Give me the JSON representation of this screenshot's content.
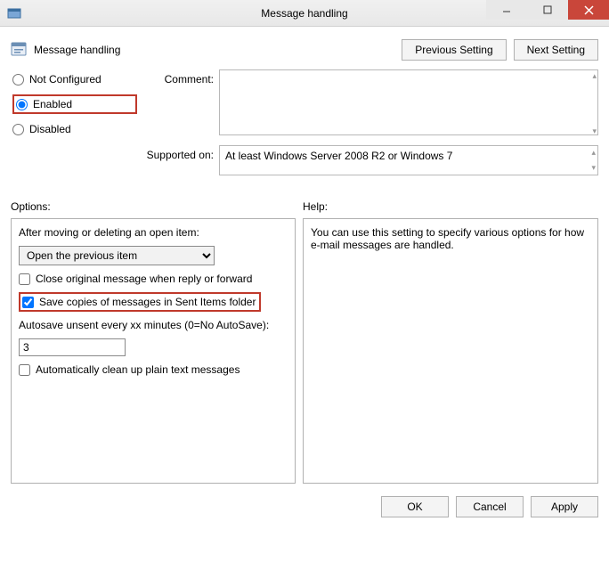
{
  "window": {
    "title": "Message handling"
  },
  "header": {
    "label": "Message handling",
    "previous_button": "Previous Setting",
    "next_button": "Next Setting"
  },
  "state": {
    "not_configured": "Not Configured",
    "enabled": "Enabled",
    "disabled": "Disabled",
    "selected": "enabled"
  },
  "comment": {
    "label": "Comment:",
    "value": ""
  },
  "supported": {
    "label": "Supported on:",
    "value": "At least Windows Server 2008 R2 or Windows 7"
  },
  "labels": {
    "options": "Options:",
    "help": "Help:"
  },
  "options": {
    "after_move_label": "After moving or deleting an open item:",
    "after_move_value": "Open the previous item",
    "close_original": {
      "label": "Close original message when reply or forward",
      "checked": false
    },
    "save_sent": {
      "label": "Save copies of messages in Sent Items folder",
      "checked": true
    },
    "autosave_label": "Autosave unsent every xx minutes (0=No AutoSave):",
    "autosave_value": "3",
    "auto_cleanup": {
      "label": "Automatically clean up plain text messages",
      "checked": false
    }
  },
  "help": {
    "text": "You can use this setting to specify various options for how e-mail messages are handled."
  },
  "footer": {
    "ok": "OK",
    "cancel": "Cancel",
    "apply": "Apply"
  }
}
